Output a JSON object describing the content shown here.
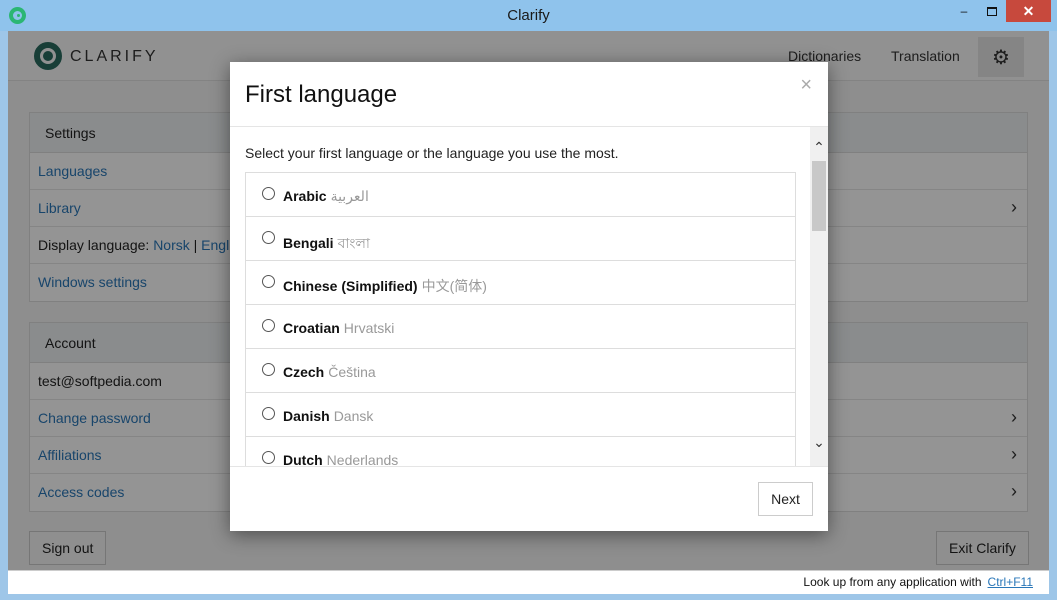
{
  "window": {
    "title": "Clarify",
    "minimize": "–",
    "close": "✕"
  },
  "header": {
    "logo": "CLARIFY",
    "nav": [
      "Dictionaries",
      "Translation"
    ],
    "settings_icon": "⚙"
  },
  "settings": {
    "heading": "Settings",
    "languages": "Languages",
    "library": "Library",
    "display_language_label": "Display language:",
    "display_language_norsk": "Norsk",
    "display_language_sep": "|",
    "display_language_english": "Engl",
    "windows_settings": "Windows settings"
  },
  "account": {
    "heading": "Account",
    "email": "test@softpedia.com",
    "change_password": "Change password",
    "affiliations": "Affiliations",
    "access_codes": "Access codes"
  },
  "footer_buttons": {
    "sign_out": "Sign out",
    "exit": "Exit Clarify"
  },
  "statusbar": {
    "text": "Look up from any application with",
    "shortcut": "Ctrl+F11"
  },
  "modal": {
    "title": "First language",
    "close": "×",
    "intro": "Select your first language or the language you use the most.",
    "languages": [
      {
        "name": "Arabic",
        "native": "العربية"
      },
      {
        "name": "Bengali",
        "native": "বাংলা"
      },
      {
        "name": "Chinese (Simplified)",
        "native": "中文(简体)"
      },
      {
        "name": "Croatian",
        "native": "Hrvatski"
      },
      {
        "name": "Czech",
        "native": "Čeština"
      },
      {
        "name": "Danish",
        "native": "Dansk"
      },
      {
        "name": "Dutch",
        "native": "Nederlands"
      }
    ],
    "next": "Next",
    "scroll_up": "⌃",
    "scroll_down": "⌄"
  },
  "chevron": "›"
}
